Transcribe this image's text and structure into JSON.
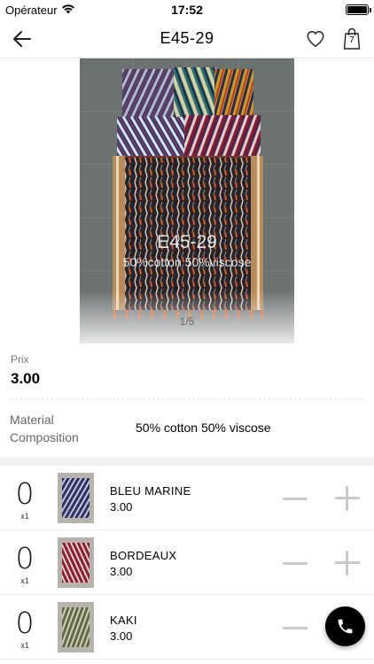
{
  "status_bar": {
    "carrier": "Opérateur",
    "time": "17:52",
    "icons": [
      "wifi-icon",
      "battery-icon"
    ]
  },
  "nav": {
    "title": "E45-29",
    "cart_count": "7",
    "icons": [
      "back-arrow-icon",
      "heart-icon",
      "shopping-bag-icon"
    ]
  },
  "hero": {
    "overlay_code": "E45-29",
    "overlay_composition": "50%cotton 50%viscose",
    "pager": "1/5"
  },
  "price": {
    "label": "Prix",
    "value": "3.00"
  },
  "material": {
    "label": "Material Composition",
    "value": "50% cotton 50% viscose"
  },
  "variants": [
    {
      "qty": "0",
      "multiplier": "x1",
      "name": "BLEU MARINE",
      "price": "3.00"
    },
    {
      "qty": "0",
      "multiplier": "x1",
      "name": "BORDEAUX",
      "price": "3.00"
    },
    {
      "qty": "0",
      "multiplier": "x1",
      "name": "KAKI",
      "price": "3.00"
    }
  ],
  "fab": {
    "icon": "phone-icon"
  },
  "colors": {
    "accent": "#000000",
    "separator": "#f2f2f2",
    "stepper": "#c8c8c8"
  }
}
